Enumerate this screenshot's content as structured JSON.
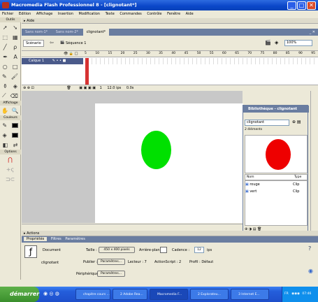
{
  "window": {
    "title": "Macromedia Flash Professionnel 8 - [clignotant*]",
    "minimize": "_",
    "maximize": "□",
    "close": "✕"
  },
  "menu": [
    "Fichier",
    "Edition",
    "Affichage",
    "Insertion",
    "Modification",
    "Texte",
    "Commandes",
    "Contrôle",
    "Fenêtre",
    "Aide"
  ],
  "toolbox": {
    "tools_label": "Outils",
    "view_label": "Affichage",
    "colors_label": "Couleurs",
    "options_label": "Options",
    "stroke_color": "#000000",
    "fill_color": "#000000"
  },
  "aide_panel": {
    "label": "Aide"
  },
  "doc_tabs": [
    "Sans nom-1*",
    "Sans nom-2*",
    "clignotant*"
  ],
  "edit_bar": {
    "scene_tab": "Scénario",
    "scene_name": "Séquence 1",
    "zoom": "100%"
  },
  "timeline": {
    "layer_name": "Calque 1",
    "frame_numbers": [
      "5",
      "10",
      "15",
      "20",
      "25",
      "30",
      "35",
      "40",
      "45",
      "50",
      "55",
      "60",
      "65",
      "70",
      "75",
      "80",
      "85",
      "90",
      "95"
    ],
    "current_frame": "1",
    "fps": "12.0 ips",
    "elapsed": "0.0s"
  },
  "library": {
    "title": "Bibliothèque - clignotant",
    "document": "clignotant",
    "count": "2 éléments",
    "col_name": "Nom",
    "col_type": "Type",
    "items": [
      {
        "name": "rouge",
        "type": "Clip"
      },
      {
        "name": "vert",
        "type": "Clip"
      }
    ]
  },
  "actions": {
    "label": "Actions"
  },
  "properties": {
    "tabs": [
      "Propriétés",
      "Filtres",
      "Paramètres"
    ],
    "doc_type": "Document",
    "doc_name": "clignotant",
    "size_label": "Taille :",
    "size_value": "450 x 400 pixels",
    "bg_label": "Arrière-plan :",
    "fps_label": "Cadence :",
    "fps_value": "12",
    "fps_unit": "ips",
    "publish_label": "Publier :",
    "params_button": "Paramètres...",
    "player_label": "Lecteur : 7",
    "actionscript_label": "ActionScript : 2",
    "profile_label": "Profil : Défaut",
    "device_label": "Périphérique :",
    "device_button": "Paramètres..."
  },
  "taskbar": {
    "start": "démarrer",
    "tasks": [
      "chapitre cours ...",
      "2 Adobe Rea...",
      "Macromedia F...",
      "2 Explorateu...",
      "3 Internet E..."
    ],
    "tray_lang": "FR",
    "clock": "07:46"
  },
  "colors": {
    "green_circle": "#00e000",
    "red_circle": "#ee0000",
    "title_blue": "#0a46c8",
    "panel_blue": "#6a7da0"
  }
}
